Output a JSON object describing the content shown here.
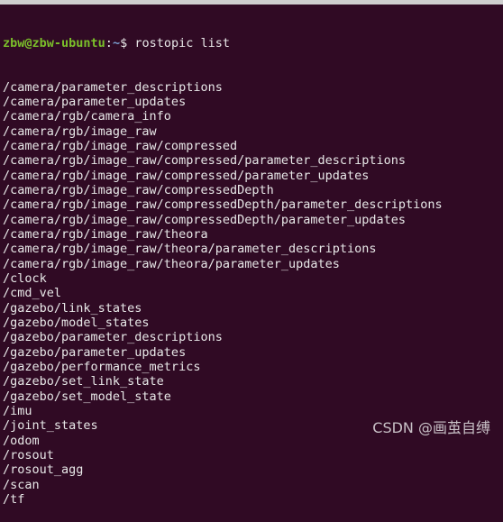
{
  "terminal": {
    "prompt_user": "zbw@zbw-ubuntu",
    "prompt_sep": ":",
    "prompt_path": "~",
    "prompt_symbol": "$ ",
    "command": "rostopic list",
    "output": [
      "/camera/parameter_descriptions",
      "/camera/parameter_updates",
      "/camera/rgb/camera_info",
      "/camera/rgb/image_raw",
      "/camera/rgb/image_raw/compressed",
      "/camera/rgb/image_raw/compressed/parameter_descriptions",
      "/camera/rgb/image_raw/compressed/parameter_updates",
      "/camera/rgb/image_raw/compressedDepth",
      "/camera/rgb/image_raw/compressedDepth/parameter_descriptions",
      "/camera/rgb/image_raw/compressedDepth/parameter_updates",
      "/camera/rgb/image_raw/theora",
      "/camera/rgb/image_raw/theora/parameter_descriptions",
      "/camera/rgb/image_raw/theora/parameter_updates",
      "/clock",
      "/cmd_vel",
      "/gazebo/link_states",
      "/gazebo/model_states",
      "/gazebo/parameter_descriptions",
      "/gazebo/parameter_updates",
      "/gazebo/performance_metrics",
      "/gazebo/set_link_state",
      "/gazebo/set_model_state",
      "/imu",
      "/joint_states",
      "/odom",
      "/rosout",
      "/rosout_agg",
      "/scan",
      "/tf"
    ]
  },
  "watermark": "CSDN @画茧自缚",
  "colors": {
    "background": "#300a24",
    "user": "#7bbf2a",
    "path": "#7a9fd0",
    "text": "#e8e8e8"
  }
}
